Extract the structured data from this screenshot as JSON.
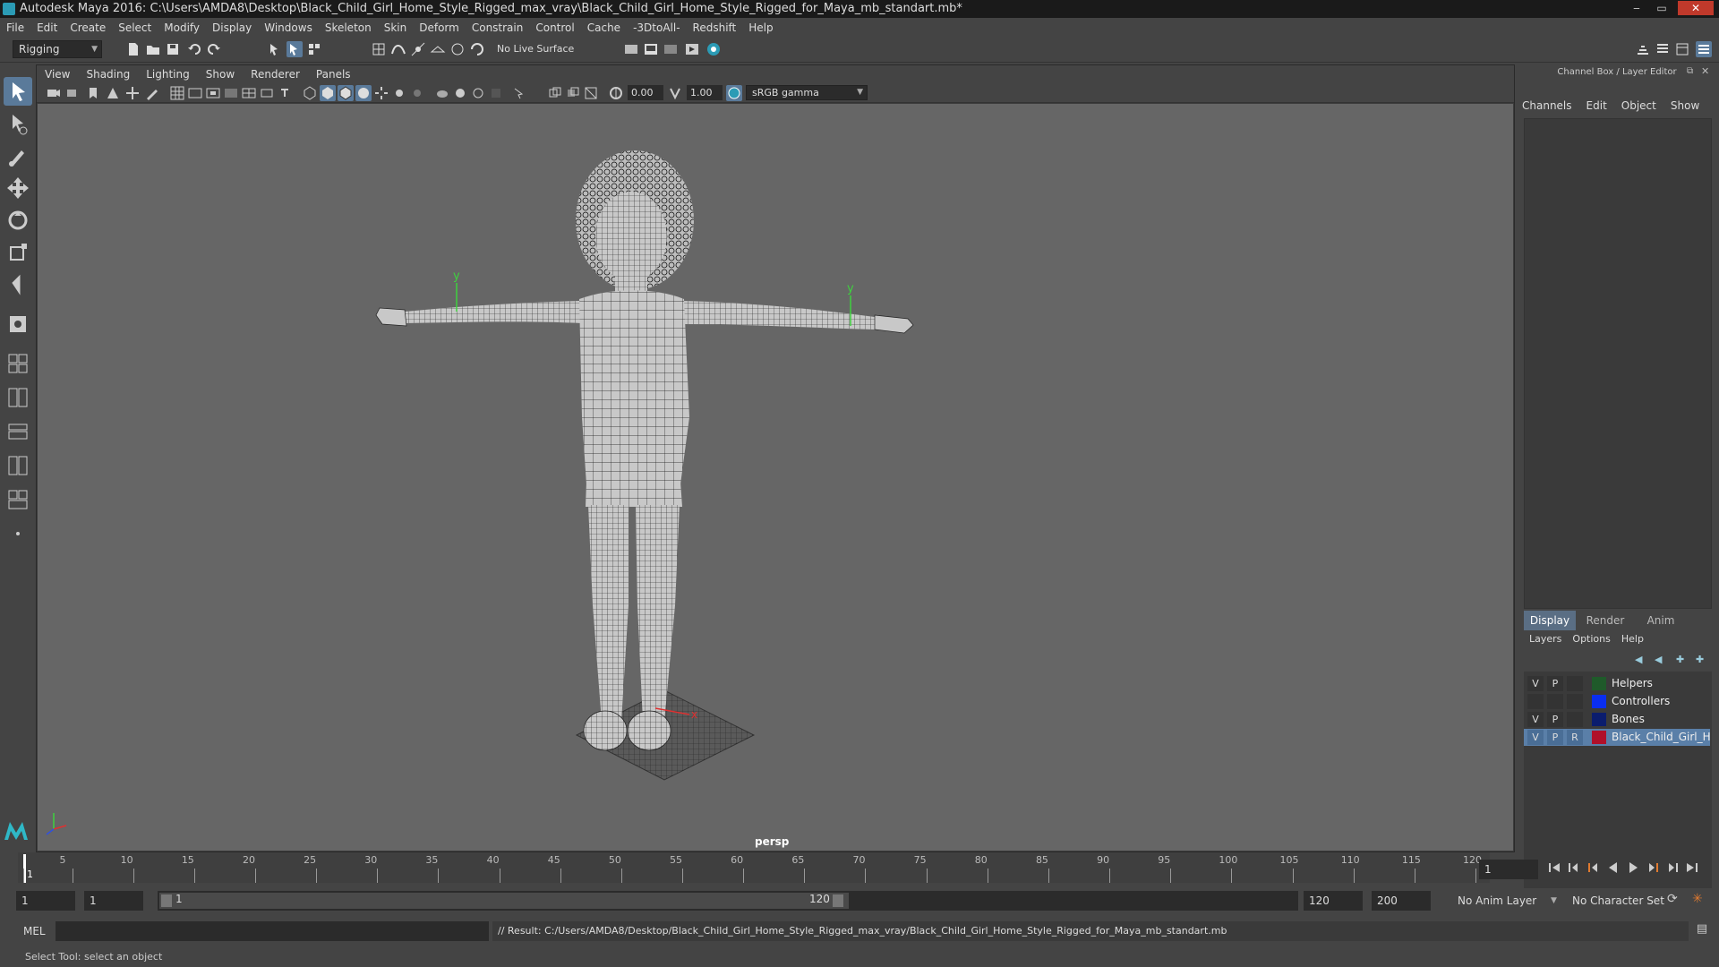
{
  "window": {
    "title": "Autodesk Maya 2016: C:\\Users\\AMDA8\\Desktop\\Black_Child_Girl_Home_Style_Rigged_max_vray\\Black_Child_Girl_Home_Style_Rigged_for_Maya_mb_standart.mb*",
    "minimize": "‒",
    "maximize": "▭",
    "close": "✕"
  },
  "menubar": [
    "File",
    "Edit",
    "Create",
    "Select",
    "Modify",
    "Display",
    "Windows",
    "Skeleton",
    "Skin",
    "Deform",
    "Constrain",
    "Control",
    "Cache",
    "-3DtoAll-",
    "Redshift",
    "Help"
  ],
  "shelf": {
    "mode_selector": "Rigging",
    "live_surface": "No Live Surface"
  },
  "panel": {
    "menus": [
      "View",
      "Shading",
      "Lighting",
      "Show",
      "Renderer",
      "Panels"
    ],
    "exposure": "0.00",
    "gamma": "1.00",
    "color_space": "sRGB gamma",
    "camera": "persp"
  },
  "channel_box": {
    "title": "Channel Box / Layer Editor",
    "menus": [
      "Channels",
      "Edit",
      "Object",
      "Show"
    ]
  },
  "layer_editor": {
    "tabs": [
      "Display",
      "Render",
      "Anim"
    ],
    "active_tab": "Display",
    "menus": [
      "Layers",
      "Options",
      "Help"
    ],
    "layers": [
      {
        "v": "V",
        "p": "P",
        "r": "",
        "name": "Helpers",
        "color": "#1f5a2a",
        "selected": false
      },
      {
        "v": "",
        "p": "",
        "r": "",
        "name": "Controllers",
        "color": "#0a2ef0",
        "selected": false
      },
      {
        "v": "V",
        "p": "P",
        "r": "",
        "name": "Bones",
        "color": "#0b1d6e",
        "selected": false
      },
      {
        "v": "V",
        "p": "P",
        "r": "R",
        "name": "Black_Child_Girl_Home",
        "color": "#b0102a",
        "selected": true
      }
    ]
  },
  "timeline": {
    "ticks": [
      "1",
      "5",
      "10",
      "15",
      "20",
      "25",
      "30",
      "35",
      "40",
      "45",
      "50",
      "55",
      "60",
      "65",
      "70",
      "75",
      "80",
      "85",
      "90",
      "95",
      "100",
      "105",
      "110",
      "115",
      "120"
    ],
    "current_frame": "1"
  },
  "range": {
    "start": "1",
    "playback_start": "1",
    "slider_start": "1",
    "slider_end": "120",
    "playback_end": "120",
    "end": "200",
    "anim_layer": "No Anim Layer",
    "character_set": "No Character Set"
  },
  "cmdline": {
    "language": "MEL",
    "result": "// Result: C:/Users/AMDA8/Desktop/Black_Child_Girl_Home_Style_Rigged_max_vray/Black_Child_Girl_Home_Style_Rigged_for_Maya_mb_standart.mb"
  },
  "helpline": "Select Tool: select an object",
  "scene": {
    "gizmo_labels": {
      "y_left": "y",
      "y_right": "y",
      "x_axis": "x"
    }
  }
}
